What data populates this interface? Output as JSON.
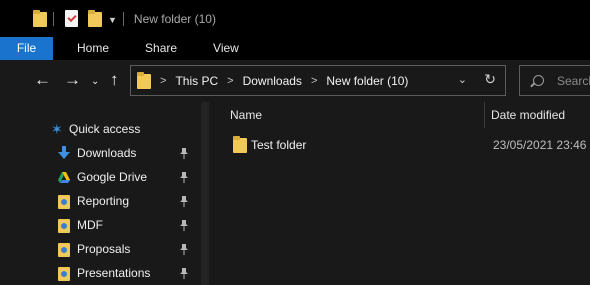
{
  "window": {
    "title": "New folder (10)"
  },
  "ribbon": {
    "tabs": [
      {
        "label": "File"
      },
      {
        "label": "Home"
      },
      {
        "label": "Share"
      },
      {
        "label": "View"
      }
    ]
  },
  "nav": {
    "breadcrumb": [
      {
        "label": "This PC"
      },
      {
        "label": "Downloads"
      },
      {
        "label": "New folder (10)"
      }
    ],
    "search": {
      "placeholder": "Search"
    }
  },
  "sidebar": {
    "quick_access": "Quick access",
    "items": [
      {
        "label": "Downloads",
        "icon": "download-arrow-icon",
        "pinned": true
      },
      {
        "label": "Google Drive",
        "icon": "google-drive-icon",
        "pinned": true
      },
      {
        "label": "Reporting",
        "icon": "user-folder-icon",
        "pinned": true
      },
      {
        "label": "MDF",
        "icon": "user-folder-icon",
        "pinned": true
      },
      {
        "label": "Proposals",
        "icon": "user-folder-icon",
        "pinned": true
      },
      {
        "label": "Presentations",
        "icon": "user-folder-icon",
        "pinned": true
      }
    ]
  },
  "content": {
    "columns": {
      "name": "Name",
      "date_modified": "Date modified"
    },
    "files": [
      {
        "name": "Test folder",
        "date_modified": "23/05/2021 23:46",
        "type": "folder"
      }
    ]
  },
  "colors": {
    "accent": "#1a73cc",
    "folder": "#f0c959",
    "background": "#191919",
    "titlebar": "#000000"
  }
}
